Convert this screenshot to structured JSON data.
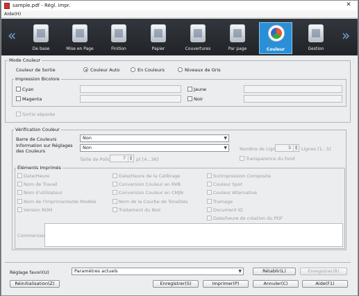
{
  "window": {
    "title": "sample.pdf - Régl. impr.",
    "close_glyph": "✕"
  },
  "menu": {
    "aide": "Aide(H)"
  },
  "nav": {
    "prev_glyph": "«",
    "next_glyph": "»"
  },
  "tabs": [
    {
      "label": "De base",
      "icon": "page-settings-icon"
    },
    {
      "label": "Mise en Page",
      "icon": "layout-icon"
    },
    {
      "label": "Finition",
      "icon": "finishing-icon"
    },
    {
      "label": "Papier",
      "icon": "paper-icon"
    },
    {
      "label": "Couvertures",
      "icon": "cover-icon"
    },
    {
      "label": "Par page",
      "icon": "per-page-icon"
    },
    {
      "label": "Couleur",
      "icon": "color-icon",
      "active": true
    },
    {
      "label": "Gestion",
      "icon": "management-icon"
    }
  ],
  "mode_couleur": {
    "title": "Mode Couleur",
    "sortie_label": "Couleur de Sortie",
    "options": [
      "Couleur Auto",
      "En Couleurs",
      "Niveaux de Gris"
    ],
    "selected": "Couleur Auto",
    "bicolore": {
      "title": "Impression Bicolore",
      "items": [
        "Cyan",
        "Magenta",
        "Jaune",
        "Noir"
      ]
    },
    "sortie_separee": "Sortie séparée"
  },
  "verification": {
    "title": "Vérification Couleur",
    "barre_label": "Barre de Couleurs",
    "barre_value": "Non",
    "info_label": "Information sur Réglages des Couleurs",
    "info_value": "Non",
    "lignes_label": "Nombre de Lignes",
    "lignes_value": "3",
    "lignes_range": "Lignes [1...5]",
    "police_label": "Taille de Police",
    "police_value": "7",
    "police_range": "pt [4...36]",
    "transparence": "Transparence du fond"
  },
  "elements": {
    "title": "Éléments Imprimés",
    "col1": [
      "Date/Heure",
      "Nom de Travail",
      "Nom d'utilisateur",
      "Nom de l'imprimante/de Modèle",
      "Version ROM"
    ],
    "col2": [
      "Date/Heure de la Calibrage",
      "Conversion Couleur en RVB",
      "Conversion Couleur en CMJN",
      "Nom de la Courbe de Tonalités",
      "Traitement du Noir"
    ],
    "col3": [
      "Surimpression Composite",
      "Couleur Spot",
      "Couleur Alternative",
      "Tramage",
      "Document ID",
      "Date/heure de création du PDF"
    ],
    "commentaire": "Commentaire"
  },
  "footer": {
    "favori_label": "Réglage favori(U)",
    "favori_value": "Paramètres actuels",
    "retablir": "Rétablir(L)",
    "enregistrer_fav": "Enregistrer(R)",
    "reinit": "Réinitialisation(Z)",
    "enregistrer": "Enregistrer(S)",
    "imprimer": "Imprimer(P)",
    "annuler": "Annuler(C)",
    "aide": "Aide(F1)"
  }
}
